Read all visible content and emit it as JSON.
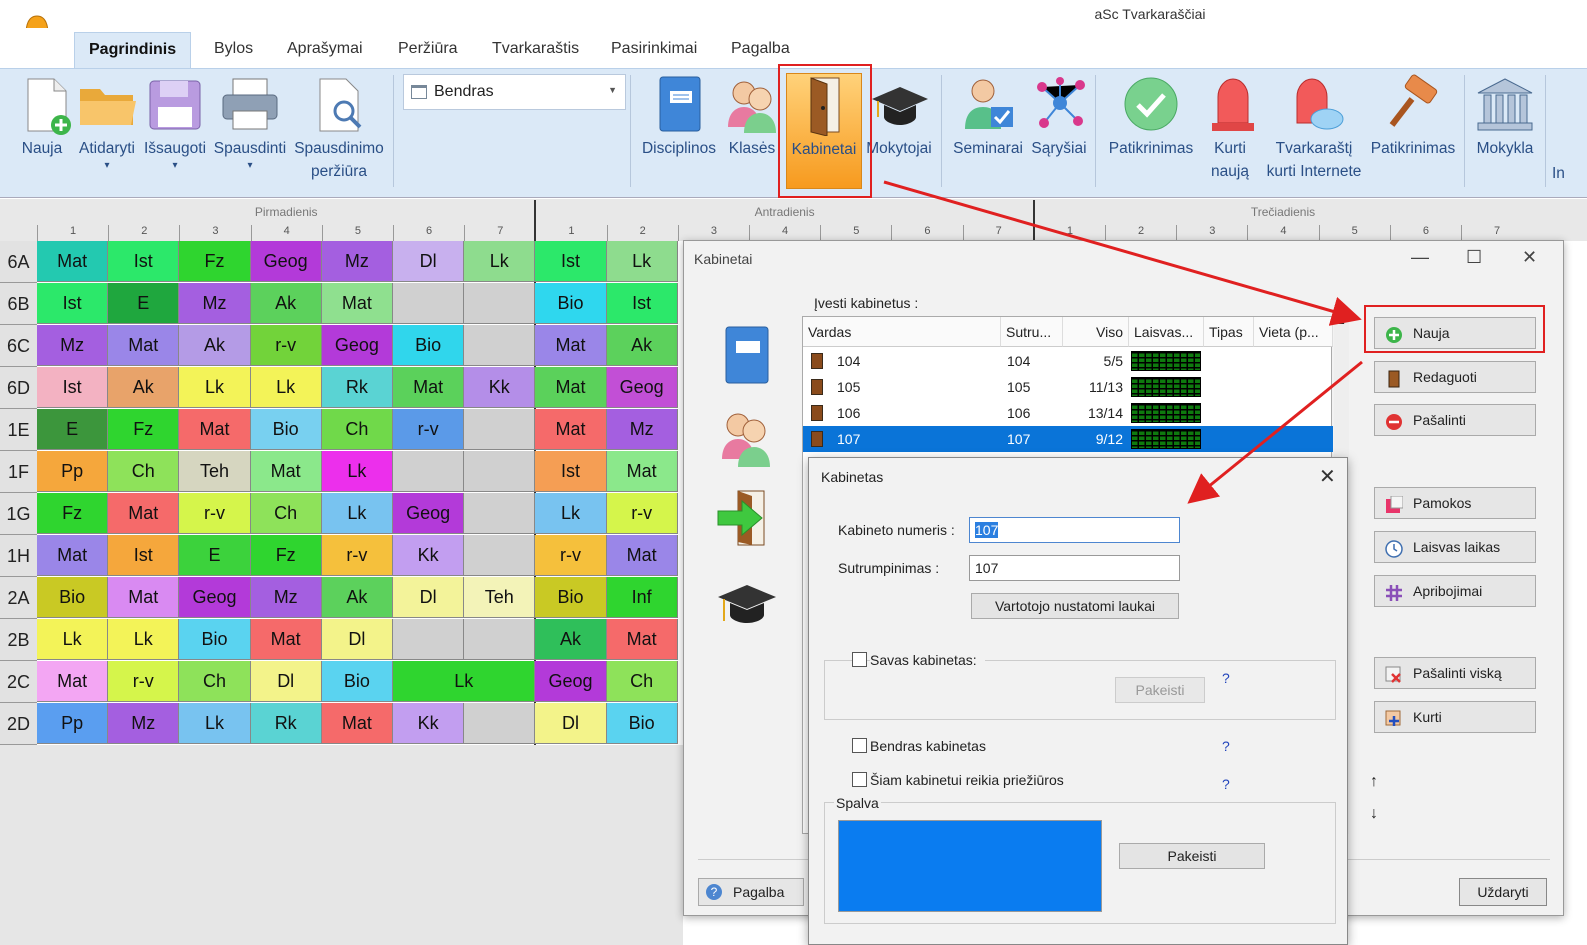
{
  "app": {
    "title": "aSc Tvarkaraščiai"
  },
  "tabs": [
    {
      "label": "Pagrindinis",
      "active": true
    },
    {
      "label": "Bylos"
    },
    {
      "label": "Aprašymai"
    },
    {
      "label": "Peržiūra"
    },
    {
      "label": "Tvarkaraštis"
    },
    {
      "label": "Pasirinkimai"
    },
    {
      "label": "Pagalba"
    }
  ],
  "ribbon": {
    "file_buttons": [
      {
        "label": "Nauja",
        "icon": "new-document-icon"
      },
      {
        "label": "Atidaryti",
        "icon": "open-folder-icon"
      },
      {
        "label": "Išsaugoti",
        "icon": "save-disk-icon"
      },
      {
        "label": "Spausdinti",
        "icon": "printer-icon"
      },
      {
        "label": "Spausdinimo",
        "label2": "peržiūra",
        "icon": "print-preview-icon"
      }
    ],
    "view_combo": "Bendras",
    "data_buttons": [
      {
        "label": "Disciplinos",
        "icon": "book-icon"
      },
      {
        "label": "Klasės",
        "icon": "students-icon"
      },
      {
        "label": "Kabinetai",
        "icon": "door-icon",
        "active": true
      },
      {
        "label": "Mokytojai",
        "icon": "graduation-cap-icon"
      },
      {
        "label": "Seminarai",
        "icon": "seminar-icon"
      },
      {
        "label": "Sąryšiai",
        "icon": "relations-icon"
      }
    ],
    "gen_buttons": [
      {
        "label": "Patikrinimas",
        "icon": "check-icon"
      },
      {
        "label": "Kurti",
        "label2": "naują",
        "icon": "siren-icon"
      },
      {
        "label": "Tvarkaraštį",
        "label2": "kurti Internete",
        "icon": "siren-cloud-icon"
      },
      {
        "label": "Patikrinimas",
        "icon": "gavel-icon"
      }
    ],
    "school_button": {
      "label": "Mokykla",
      "icon": "school-building-icon"
    },
    "cut_label": "In"
  },
  "timetable": {
    "days": [
      "Pirmadienis",
      "Antradienis",
      "Trečiadienis"
    ],
    "periods": [
      "1",
      "2",
      "3",
      "4",
      "5",
      "6",
      "7"
    ],
    "rows": [
      {
        "cls": "6A",
        "cells": [
          [
            "Mat",
            "#23c9b0"
          ],
          [
            "Ist",
            "#2ce86a"
          ],
          [
            "Fz",
            "#2fd52f"
          ],
          [
            "Geog",
            "#b33ad9"
          ],
          [
            "Mz",
            "#a45fe0"
          ],
          [
            "Dl",
            "#c8b0ee"
          ],
          [
            "Lk",
            "#8edc8e"
          ],
          [
            "Ist",
            "#2ce86a"
          ],
          [
            "Lk",
            "#8edc8e"
          ]
        ]
      },
      {
        "cls": "6B",
        "cells": [
          [
            "Ist",
            "#2ce86a"
          ],
          [
            "E",
            "#1fa73e"
          ],
          [
            "Mz",
            "#a45fe0"
          ],
          [
            "Ak",
            "#5cd15c"
          ],
          [
            "Mat",
            "#8fe08f"
          ],
          [
            "",
            ""
          ],
          [
            "",
            ""
          ],
          [
            "Bio",
            "#2fd7ee"
          ],
          [
            "Ist",
            "#2ce86a"
          ]
        ]
      },
      {
        "cls": "6C",
        "cells": [
          [
            "Mz",
            "#a45fe0"
          ],
          [
            "Mat",
            "#9a86e8"
          ],
          [
            "Ak",
            "#b49be6"
          ],
          [
            "r-v",
            "#72d33a"
          ],
          [
            "Geog",
            "#b33ad9"
          ],
          [
            "Bio",
            "#30d6ec"
          ],
          [
            "",
            ""
          ],
          [
            "Mat",
            "#9a86e8"
          ],
          [
            "Ak",
            "#5cd15c"
          ]
        ]
      },
      {
        "cls": "6D",
        "cells": [
          [
            "Ist",
            "#f3b2c2"
          ],
          [
            "Ak",
            "#e8a36a"
          ],
          [
            "Lk",
            "#f3f358"
          ],
          [
            "Lk",
            "#f3f358"
          ],
          [
            "Rk",
            "#5ad3d3"
          ],
          [
            "Mat",
            "#5bd15b"
          ],
          [
            "Kk",
            "#b48ee8"
          ],
          [
            "Mat",
            "#5bd15b"
          ],
          [
            "Geog",
            "#c24fd6"
          ]
        ]
      },
      {
        "cls": "1E",
        "cells": [
          [
            "E",
            "#3c963c"
          ],
          [
            "Fz",
            "#2fd52f"
          ],
          [
            "Mat",
            "#f56a6a"
          ],
          [
            "Bio",
            "#78d0f0"
          ],
          [
            "Ch",
            "#70d94a"
          ],
          [
            "r-v",
            "#5b9ae8"
          ],
          [
            "",
            ""
          ],
          [
            "Mat",
            "#f56a6a"
          ],
          [
            "Mz",
            "#a45fe0"
          ]
        ]
      },
      {
        "cls": "1F",
        "cells": [
          [
            "Pp",
            "#f5a73c"
          ],
          [
            "Ch",
            "#8ee25a"
          ],
          [
            "Teh",
            "#d6d6c0"
          ],
          [
            "Mat",
            "#8be88b"
          ],
          [
            "Lk",
            "#ec2fec"
          ],
          [
            "",
            ""
          ],
          [
            "",
            ""
          ],
          [
            "Ist",
            "#f59e54"
          ],
          [
            "Mat",
            "#8be88b"
          ]
        ]
      },
      {
        "cls": "1G",
        "cells": [
          [
            "Fz",
            "#2fd52f"
          ],
          [
            "Mat",
            "#f56a6a"
          ],
          [
            "r-v",
            "#d5f54b"
          ],
          [
            "Ch",
            "#8ee25a"
          ],
          [
            "Lk",
            "#78c3f0"
          ],
          [
            "Geog",
            "#b33ad9"
          ],
          [
            "",
            ""
          ],
          [
            "Lk",
            "#78c3f0"
          ],
          [
            "r-v",
            "#d5f54b"
          ]
        ]
      },
      {
        "cls": "1H",
        "cells": [
          [
            "Mat",
            "#9a86e8"
          ],
          [
            "Ist",
            "#f5a73c"
          ],
          [
            "E",
            "#3cd23c"
          ],
          [
            "Fz",
            "#2fd52f"
          ],
          [
            "r-v",
            "#f5c03c"
          ],
          [
            "Kk",
            "#c29ef0"
          ],
          [
            "",
            ""
          ],
          [
            "r-v",
            "#f5c03c"
          ],
          [
            "Mat",
            "#9a86e8"
          ]
        ]
      },
      {
        "cls": "2A",
        "cells": [
          [
            "Bio",
            "#c9c924"
          ],
          [
            "Mat",
            "#d98af2"
          ],
          [
            "Geog",
            "#b33ad9"
          ],
          [
            "Mz",
            "#a45fe0"
          ],
          [
            "Ak",
            "#5cd15c"
          ],
          [
            "Dl",
            "#f3f39a"
          ],
          [
            "Teh",
            "#f3f3b8"
          ],
          [
            "Bio",
            "#c9c924"
          ],
          [
            "Inf",
            "#2fd52f"
          ]
        ]
      },
      {
        "cls": "2B",
        "cells": [
          [
            "Lk",
            "#f3f358"
          ],
          [
            "Lk",
            "#f3f358"
          ],
          [
            "Bio",
            "#5ad3f0"
          ],
          [
            "Mat",
            "#f56a6a"
          ],
          [
            "Dl",
            "#f3f38a"
          ],
          [
            "",
            ""
          ],
          [
            "",
            ""
          ],
          [
            "Ak",
            "#2fbf5a"
          ],
          [
            "Mat",
            "#f56a6a"
          ]
        ]
      },
      {
        "cls": "2C",
        "cells": [
          [
            "Mat",
            "#f3a6f3"
          ],
          [
            "r-v",
            "#d5f54b"
          ],
          [
            "Ch",
            "#8ee25a"
          ],
          [
            "Dl",
            "#f3f38a"
          ],
          [
            "Bio",
            "#5ad3f0"
          ],
          [
            "Lk",
            "#2fd52f"
          ],
          [
            "",
            ""
          ],
          [
            "Geog",
            "#b33ad9"
          ],
          [
            "Ch",
            "#8ee25a"
          ]
        ]
      },
      {
        "cls": "2D",
        "cells": [
          [
            "Pp",
            "#5a9ef0"
          ],
          [
            "Mz",
            "#a45fe0"
          ],
          [
            "Lk",
            "#78c3f0"
          ],
          [
            "Rk",
            "#5ad3d3"
          ],
          [
            "Mat",
            "#f56a6a"
          ],
          [
            "Kk",
            "#c29ef0"
          ],
          [
            "",
            ""
          ],
          [
            "Dl",
            "#f3f38a"
          ],
          [
            "Bio",
            "#5ad3f0"
          ]
        ]
      }
    ]
  },
  "rooms_window": {
    "title": "Kabinetai",
    "list_label": "Įvesti kabinetus :",
    "columns": [
      "Vardas",
      "Sutru...",
      "Viso",
      "Laisvas...",
      "Tipas",
      "Vieta (p..."
    ],
    "rows": [
      {
        "name": "104",
        "short": "104",
        "total": "5/5"
      },
      {
        "name": "105",
        "short": "105",
        "total": "11/13"
      },
      {
        "name": "106",
        "short": "106",
        "total": "13/14"
      },
      {
        "name": "107",
        "short": "107",
        "total": "9/12",
        "selected": true
      }
    ],
    "buttons": [
      {
        "label": "Nauja",
        "icon": "plus-icon"
      },
      {
        "label": "Redaguoti",
        "icon": "door-icon"
      },
      {
        "label": "Pašalinti",
        "icon": "remove-icon"
      },
      {
        "label": "Pamokos",
        "icon": "lessons-icon"
      },
      {
        "label": "Laisvas laikas",
        "icon": "clock-icon"
      },
      {
        "label": "Apribojimai",
        "icon": "hash-icon"
      },
      {
        "label": "Pašalinti viską",
        "icon": "delete-all-icon"
      },
      {
        "label": "Kurti",
        "icon": "create-icon"
      }
    ],
    "help_label": "Pagalba",
    "close_label": "Uždaryti"
  },
  "room_dialog": {
    "title": "Kabinetas",
    "number_label": "Kabineto numeris :",
    "number_value": "107",
    "short_label": "Sutrumpinimas :",
    "short_value": "107",
    "custom_fields_label": "Vartotojo nustatomi laukai",
    "own_room_label": "Savas kabinetas:",
    "change_label": "Pakeisti",
    "shared_room_label": "Bendras kabinetas",
    "supervision_label": "Šiam kabinetui reikia priežiūros",
    "color_label": "Spalva",
    "color_value": "#0a7cf0",
    "color_change_label": "Pakeisti",
    "help_mark": "?"
  }
}
